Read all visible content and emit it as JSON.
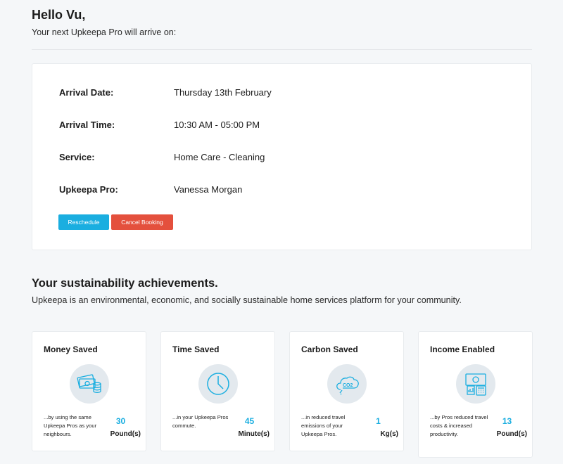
{
  "greeting": {
    "title": "Hello Vu,",
    "subtitle": "Your next Upkeepa Pro will arrive on:"
  },
  "booking": {
    "rows": [
      {
        "label": "Arrival Date:",
        "value": "Thursday 13th February"
      },
      {
        "label": "Arrival Time:",
        "value": "10:30 AM - 05:00 PM"
      },
      {
        "label": "Service:",
        "value": "Home Care - Cleaning"
      },
      {
        "label": "Upkeepa Pro:",
        "value": "Vanessa Morgan"
      }
    ],
    "reschedule_label": "Reschedule",
    "cancel_label": "Cancel Booking",
    "colors": {
      "reschedule": "#1aaee0",
      "cancel": "#e4503d"
    }
  },
  "sustainability": {
    "title": "Your sustainability achievements.",
    "description": "Upkeepa is an environmental, economic, and socially sustainable home services platform for your community."
  },
  "cards": [
    {
      "title": "Money Saved",
      "icon": "money-icon",
      "description": "...by using the same Upkeepa Pros as your neighbours.",
      "value": "30",
      "unit": "Pound(s)"
    },
    {
      "title": "Time Saved",
      "icon": "clock-icon",
      "description": "...in your Upkeepa Pros commute.",
      "value": "45",
      "unit": "Minute(s)"
    },
    {
      "title": "Carbon Saved",
      "icon": "co2-cloud-icon",
      "description": "...in reduced travel emissions of your Upkeepa Pros.",
      "value": "1",
      "unit": "Kg(s)"
    },
    {
      "title": "Income Enabled",
      "icon": "income-calculator-icon",
      "description": "...by Pros reduced travel costs & increased productivity.",
      "value": "13",
      "unit": "Pound(s)"
    }
  ],
  "accent_color": "#1aaee0"
}
